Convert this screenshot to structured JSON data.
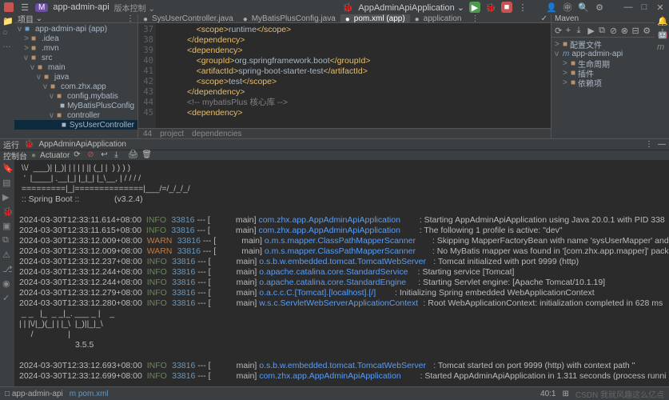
{
  "titlebar": {
    "badge": "M",
    "project": "app-admin-api",
    "version_label": "版本控制",
    "run_config": "AppAdminApiApplication"
  },
  "sidebar": {
    "header": "项目",
    "items": [
      {
        "indent": 0,
        "chev": "v",
        "icon": "mod",
        "label": "app-admin-api (app)",
        "hint": ""
      },
      {
        "indent": 1,
        "chev": ">",
        "icon": "folder",
        "label": ".idea"
      },
      {
        "indent": 1,
        "chev": ">",
        "icon": "folder",
        "label": ".mvn"
      },
      {
        "indent": 1,
        "chev": "v",
        "icon": "folder",
        "label": "src"
      },
      {
        "indent": 2,
        "chev": "v",
        "icon": "folder",
        "label": "main"
      },
      {
        "indent": 3,
        "chev": "v",
        "icon": "folder",
        "label": "java"
      },
      {
        "indent": 4,
        "chev": "v",
        "icon": "folder",
        "label": "com.zhx.app"
      },
      {
        "indent": 5,
        "chev": "v",
        "icon": "folder",
        "label": "config.mybatis"
      },
      {
        "indent": 6,
        "chev": "",
        "icon": "file",
        "label": "MyBatisPlusConfig"
      },
      {
        "indent": 5,
        "chev": "v",
        "icon": "folder",
        "label": "controller"
      },
      {
        "indent": 6,
        "chev": "",
        "icon": "file",
        "label": "SysUserController",
        "selected": true
      }
    ]
  },
  "editor": {
    "tabs": [
      "SysUserController.java",
      "MyBatisPlusConfig.java",
      "pom.xml (app)",
      "application"
    ],
    "active_tab": 2,
    "gutter_start": 37,
    "lines": [
      {
        "parts": [
          {
            "t": "                <scope>",
            "c": "tag"
          },
          {
            "t": "runtime",
            "c": "text"
          },
          {
            "t": "</scope>",
            "c": "tag"
          }
        ]
      },
      {
        "parts": [
          {
            "t": "            </dependency>",
            "c": "tag"
          }
        ]
      },
      {
        "parts": [
          {
            "t": "            <dependency>",
            "c": "tag"
          }
        ]
      },
      {
        "parts": [
          {
            "t": "                <groupId>",
            "c": "tag"
          },
          {
            "t": "org.springframework.boot",
            "c": "text"
          },
          {
            "t": "</groupId>",
            "c": "tag"
          }
        ]
      },
      {
        "parts": [
          {
            "t": "                <artifactId>",
            "c": "tag"
          },
          {
            "t": "spring-boot-starter-test",
            "c": "text"
          },
          {
            "t": "</artifactId>",
            "c": "tag"
          }
        ]
      },
      {
        "parts": [
          {
            "t": "                <scope>",
            "c": "tag"
          },
          {
            "t": "test",
            "c": "text"
          },
          {
            "t": "</scope>",
            "c": "tag"
          }
        ]
      },
      {
        "parts": [
          {
            "t": "            </dependency>",
            "c": "tag"
          }
        ]
      },
      {
        "parts": [
          {
            "t": "            <!-- mybatisPlus 核心库 -->",
            "c": "comment"
          }
        ]
      },
      {
        "parts": [
          {
            "t": "            <dependency>",
            "c": "tag"
          }
        ]
      }
    ],
    "bottom_left": "project",
    "bottom_right": "dependencies"
  },
  "maven": {
    "header": "Maven",
    "items": [
      {
        "indent": 0,
        "chev": ">",
        "label": "配置文件"
      },
      {
        "indent": 0,
        "chev": "v",
        "label": "app-admin-api",
        "mod": true
      },
      {
        "indent": 1,
        "chev": ">",
        "label": "生命周期"
      },
      {
        "indent": 1,
        "chev": ">",
        "label": "插件"
      },
      {
        "indent": 1,
        "chev": ">",
        "label": "依赖项"
      }
    ]
  },
  "run": {
    "header_label": "运行",
    "config": "AppAdminApiApplication",
    "tab_console": "控制台",
    "tab_actuator": "Actuator",
    "banner": [
      " \\\\/  ___)| |_)| | | | | || (_| |  ) ) ) )",
      "  '  |____| .__|_| |_|_| |_\\__, | / / / /",
      " =========|_|==============|___/=/_/_/_/",
      " :: Spring Boot ::               (v3.2.4)"
    ],
    "lines": [
      {
        "ts": "2024-03-30T12:33:11.614+08:00",
        "lvl": "INFO",
        "pid": "33816",
        "thread": "main",
        "src": "com.zhx.app.AppAdminApiApplication",
        "msg": ": Starting AppAdminApiApplication using Java 20.0.1 with PID 338"
      },
      {
        "ts": "2024-03-30T12:33:11.615+08:00",
        "lvl": "INFO",
        "pid": "33816",
        "thread": "main",
        "src": "com.zhx.app.AppAdminApiApplication",
        "msg": ": The following 1 profile is active: \"dev\""
      },
      {
        "ts": "2024-03-30T12:33:12.009+08:00",
        "lvl": "WARN",
        "pid": "33816",
        "thread": "main",
        "src": "o.m.s.mapper.ClassPathMapperScanner",
        "msg": ": Skipping MapperFactoryBean with name 'sysUserMapper' and 'com."
      },
      {
        "ts": "2024-03-30T12:33:12.009+08:00",
        "lvl": "WARN",
        "pid": "33816",
        "thread": "main",
        "src": "o.m.s.mapper.ClassPathMapperScanner",
        "msg": ": No MyBatis mapper was found in '[com.zhx.app.mapper]' package."
      },
      {
        "ts": "2024-03-30T12:33:12.237+08:00",
        "lvl": "INFO",
        "pid": "33816",
        "thread": "main",
        "src": "o.s.b.w.embedded.tomcat.TomcatWebServer",
        "msg": ": Tomcat initialized with port 9999 (http)"
      },
      {
        "ts": "2024-03-30T12:33:12.244+08:00",
        "lvl": "INFO",
        "pid": "33816",
        "thread": "main",
        "src": "o.apache.catalina.core.StandardService",
        "msg": ": Starting service [Tomcat]"
      },
      {
        "ts": "2024-03-30T12:33:12.244+08:00",
        "lvl": "INFO",
        "pid": "33816",
        "thread": "main",
        "src": "o.apache.catalina.core.StandardEngine",
        "msg": ": Starting Servlet engine: [Apache Tomcat/10.1.19]"
      },
      {
        "ts": "2024-03-30T12:33:12.279+08:00",
        "lvl": "INFO",
        "pid": "33816",
        "thread": "main",
        "src": "o.a.c.c.C.[Tomcat].[localhost].[/]",
        "msg": ": Initializing Spring embedded WebApplicationContext"
      },
      {
        "ts": "2024-03-30T12:33:12.280+08:00",
        "lvl": "INFO",
        "pid": "33816",
        "thread": "main",
        "src": "w.s.c.ServletWebServerApplicationContext",
        "msg": ": Root WebApplicationContext: initialization completed in 628 ms"
      }
    ],
    "mybatis_banner": [
      " _ _   |_  _ _|_. ___ _ |    _ ",
      "| | |\\/|_)(_| | |_\\  |_)||_|_\\ ",
      "     /               |         ",
      "                        3.5.5"
    ],
    "lines2": [
      {
        "ts": "2024-03-30T12:33:12.693+08:00",
        "lvl": "INFO",
        "pid": "33816",
        "thread": "main",
        "src": "o.s.b.w.embedded.tomcat.TomcatWebServer",
        "msg": ": Tomcat started on port 9999 (http) with context path ''"
      },
      {
        "ts": "2024-03-30T12:33:12.699+08:00",
        "lvl": "INFO",
        "pid": "33816",
        "thread": "main",
        "src": "com.zhx.app.AppAdminApiApplication",
        "msg": ": Started AppAdminApiApplication in 1.311 seconds (process runni"
      }
    ]
  },
  "statusbar": {
    "breadcrumb1": "app-admin-api",
    "breadcrumb2": "pom.xml",
    "cursor": "40:1",
    "watermark": "CSDN 我就风趣这么亿点"
  }
}
